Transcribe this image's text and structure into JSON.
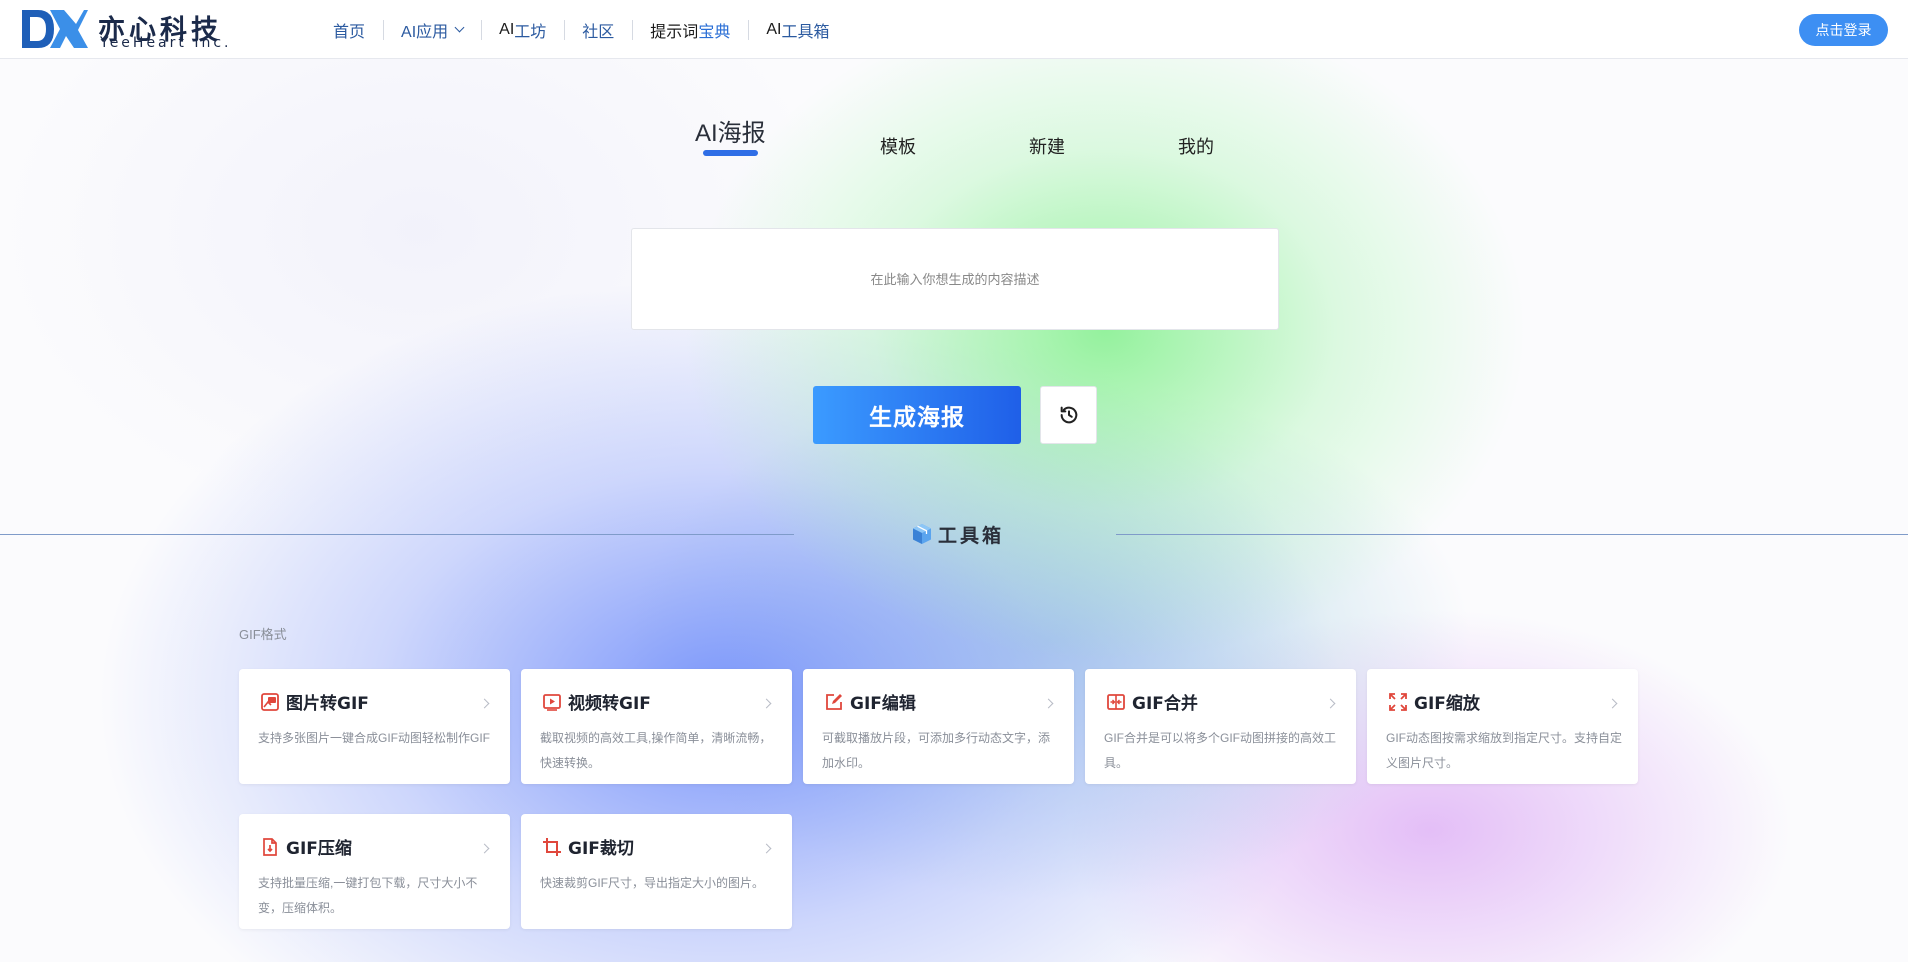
{
  "header": {
    "logo": {
      "cn": "亦心科技",
      "en": "YeeHeart Inc."
    },
    "nav": [
      {
        "id": "home",
        "parts": [
          {
            "text": "首页",
            "style": ""
          }
        ]
      },
      {
        "id": "ai-apps",
        "parts": [
          {
            "text": "AI应用",
            "style": ""
          }
        ],
        "dropdown": true
      },
      {
        "id": "ai-workshop",
        "parts": [
          {
            "text": "AI",
            "style": "dark"
          },
          {
            "text": "工坊",
            "style": ""
          }
        ]
      },
      {
        "id": "community",
        "parts": [
          {
            "text": "社区",
            "style": ""
          }
        ]
      },
      {
        "id": "prompt-dict",
        "parts": [
          {
            "text": "提示词",
            "style": "dark"
          },
          {
            "text": "宝典",
            "style": "blue"
          }
        ]
      },
      {
        "id": "ai-toolbox",
        "parts": [
          {
            "text": "AI",
            "style": "dark"
          },
          {
            "text": "工具箱",
            "style": ""
          }
        ]
      }
    ],
    "login_label": "点击登录"
  },
  "tabs": [
    {
      "label": "AI海报",
      "active": true
    },
    {
      "label": "模板",
      "active": false
    },
    {
      "label": "新建",
      "active": false
    },
    {
      "label": "我的",
      "active": false
    }
  ],
  "prompt": {
    "placeholder": "在此输入你想生成的内容描述",
    "value": ""
  },
  "generate_label": "生成海报",
  "history_icon": "history-icon",
  "toolbox": {
    "title": "工具箱",
    "icon": "box-icon"
  },
  "section_label": "GIF格式",
  "accent_color": "#3d8ff3",
  "icon_color": "#e0473c",
  "tools": [
    {
      "title": "图片转GIF",
      "desc": "支持多张图片一键合成GIF动图轻松制作GIF",
      "icon": "image-gif-icon"
    },
    {
      "title": "视频转GIF",
      "desc": "截取视频的高效工具,操作简单，清晰流畅，快速转换。",
      "icon": "video-icon"
    },
    {
      "title": "GIF编辑",
      "desc": "可截取播放片段，可添加多行动态文字，添加水印。",
      "icon": "edit-icon"
    },
    {
      "title": "GIF合并",
      "desc": "GIF合并是可以将多个GIF动图拼接的高效工具。",
      "icon": "merge-icon"
    },
    {
      "title": "GIF缩放",
      "desc": "GIF动态图按需求缩放到指定尺寸。支持自定义图片尺寸。",
      "icon": "resize-icon"
    },
    {
      "title": "GIF压缩",
      "desc": "支持批量压缩,一键打包下载，尺寸大小不变，压缩体积。",
      "icon": "compress-icon"
    },
    {
      "title": "GIF裁切",
      "desc": "快速裁剪GIF尺寸，导出指定大小的图片。",
      "icon": "crop-icon"
    }
  ]
}
